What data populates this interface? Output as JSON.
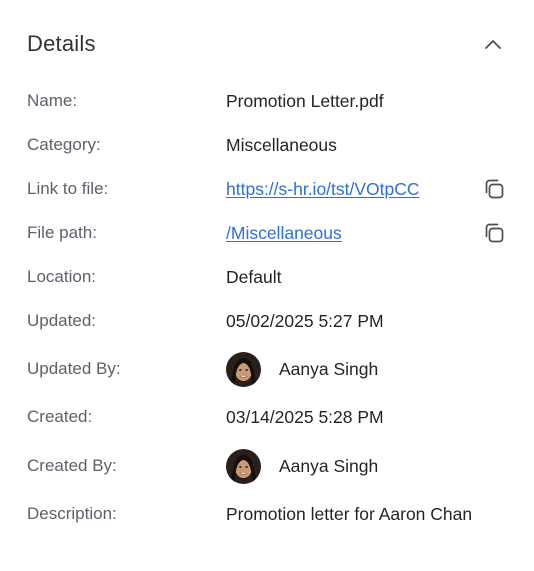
{
  "header": {
    "title": "Details",
    "collapse_icon": "chevron-up-icon"
  },
  "fields": {
    "name": {
      "label": "Name:",
      "value": "Promotion Letter.pdf"
    },
    "category": {
      "label": "Category:",
      "value": "Miscellaneous"
    },
    "link_to_file": {
      "label": "Link to file:",
      "value": "https://s-hr.io/tst/VOtpCC",
      "copy_icon": "copy-icon"
    },
    "file_path": {
      "label": "File path:",
      "value": "/Miscellaneous",
      "copy_icon": "copy-icon"
    },
    "location": {
      "label": "Location:",
      "value": "Default"
    },
    "updated": {
      "label": "Updated:",
      "value": "05/02/2025 5:27 PM"
    },
    "updated_by": {
      "label": "Updated By:",
      "value": "Aanya Singh"
    },
    "created": {
      "label": "Created:",
      "value": "03/14/2025 5:28 PM"
    },
    "created_by": {
      "label": "Created By:",
      "value": "Aanya Singh"
    },
    "description": {
      "label": "Description:",
      "value": "Promotion letter for Aaron Chan"
    }
  },
  "colors": {
    "link": "#2f6fd8",
    "label": "#5b626b",
    "value": "#1f2328"
  }
}
